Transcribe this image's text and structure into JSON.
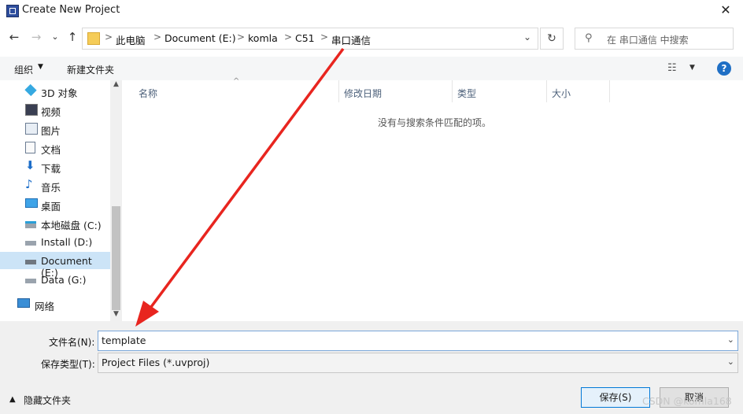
{
  "window": {
    "title": "Create New Project",
    "close": "✕"
  },
  "nav": {
    "back": "←",
    "forward": "→",
    "recent": "⌄",
    "up": "↑",
    "breadcrumb": [
      "此电脑",
      "Document (E:)",
      "komla",
      "C51",
      "串口通信"
    ],
    "separator": ">",
    "refresh": "↻",
    "search_placeholder": "在 串口通信 中搜索"
  },
  "toolbar": {
    "organize": "组织",
    "new_folder": "新建文件夹",
    "help": "?"
  },
  "sidebar": {
    "items": [
      {
        "label": "3D 对象",
        "icon": "cube-icon"
      },
      {
        "label": "视频",
        "icon": "video-icon"
      },
      {
        "label": "图片",
        "icon": "picture-icon"
      },
      {
        "label": "文档",
        "icon": "document-icon"
      },
      {
        "label": "下载",
        "icon": "download-icon"
      },
      {
        "label": "音乐",
        "icon": "music-icon"
      },
      {
        "label": "桌面",
        "icon": "desktop-icon"
      },
      {
        "label": "本地磁盘 (C:)",
        "icon": "drive-icon"
      },
      {
        "label": "Install (D:)",
        "icon": "drive-icon"
      },
      {
        "label": "Document (E:)",
        "icon": "drive-icon",
        "selected": true
      },
      {
        "label": "Data (G:)",
        "icon": "drive-icon"
      },
      {
        "label": "网络",
        "icon": "network-icon"
      }
    ]
  },
  "list": {
    "columns": [
      "名称",
      "修改日期",
      "类型",
      "大小"
    ],
    "empty_message": "没有与搜索条件匹配的项。"
  },
  "form": {
    "filename_label": "文件名(N):",
    "filename_value": "template",
    "filetype_label": "保存类型(T):",
    "filetype_value": "Project Files (*.uvproj)",
    "hide_folders": "隐藏文件夹",
    "save": "保存(S)",
    "cancel": "取消"
  },
  "watermark": "CSDN @komla168",
  "colors": {
    "accent": "#0078d7",
    "arrow": "#e8251f",
    "selection": "#cce4f7"
  }
}
